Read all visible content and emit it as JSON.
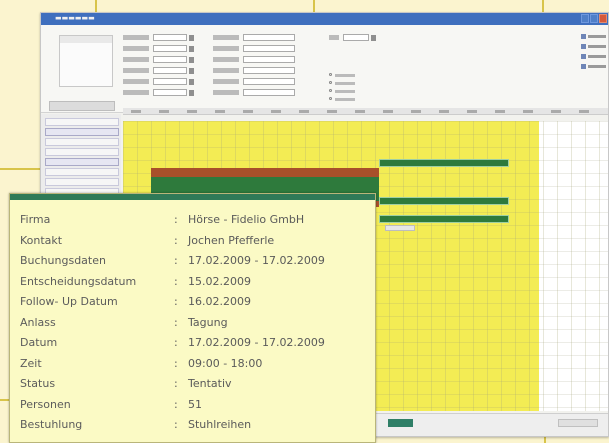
{
  "colors": {
    "background": "#fbf4cf",
    "callout_line": "#d8c44a",
    "window_title": "#3f6fbe",
    "schedule_yellow": "#f3ec54",
    "booking_green": "#2e7a3c",
    "booking_brown": "#a8502a",
    "popup_background": "#fbfac5",
    "popup_header": "#2f7a58"
  },
  "booking_popup": {
    "separator": ":",
    "rows": [
      {
        "key": "Firma",
        "value": "Hörse - Fidelio GmbH"
      },
      {
        "key": "Kontakt",
        "value": "Jochen Pfefferle"
      },
      {
        "key": "Buchungsdaten",
        "value": "17.02.2009 - 17.02.2009"
      },
      {
        "key": "Entscheidungsdatum",
        "value": "15.02.2009"
      },
      {
        "key": "Follow- Up Datum",
        "value": "16.02.2009"
      },
      {
        "key": "Anlass",
        "value": "Tagung"
      },
      {
        "key": "Datum",
        "value": "17.02.2009 - 17.02.2009"
      },
      {
        "key": "Zeit",
        "value": "09:00 - 18:00"
      },
      {
        "key": "Status",
        "value": "Tentativ"
      },
      {
        "key": "Personen",
        "value": "51"
      },
      {
        "key": "Bestuhlung",
        "value": "Stuhlreihen"
      }
    ]
  },
  "toolbar": {
    "window_controls": [
      "minimize-icon",
      "maximize-icon",
      "close-icon"
    ],
    "side_actions": [
      "print-icon",
      "refresh-icon",
      "export-icon",
      "settings-icon"
    ]
  }
}
